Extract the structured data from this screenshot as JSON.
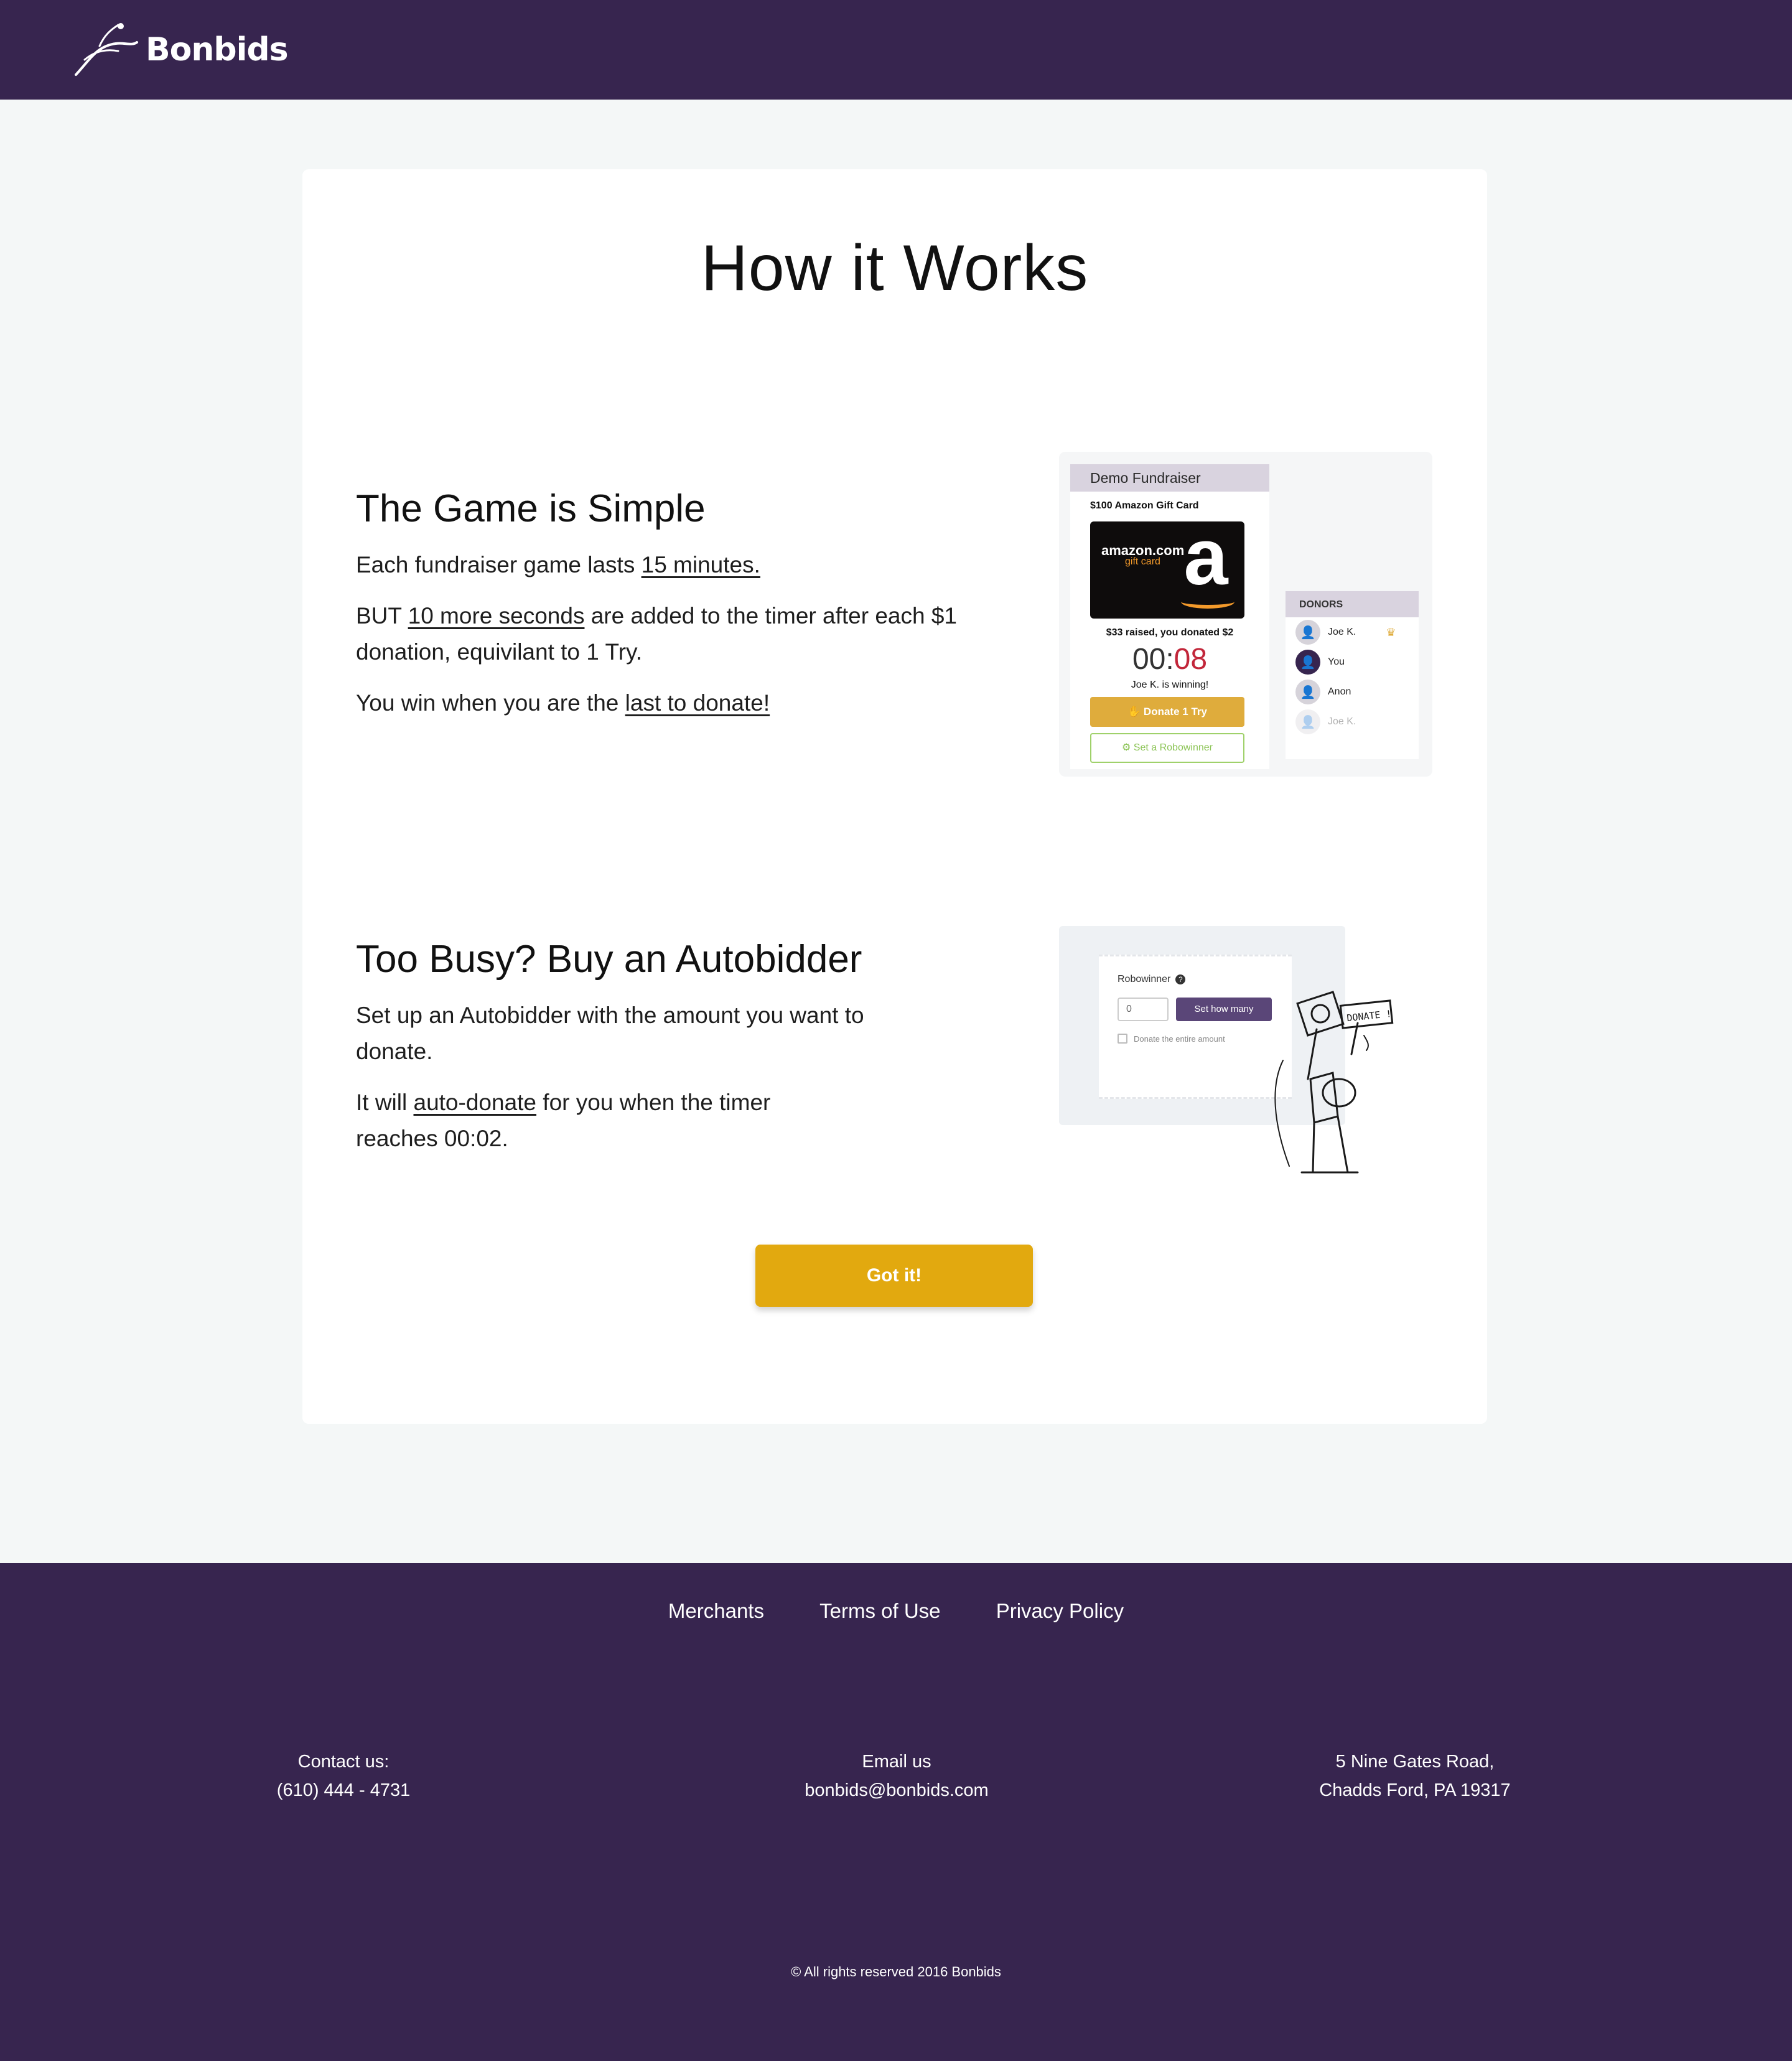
{
  "header": {
    "logo_text": "Bonbids"
  },
  "main": {
    "title": "How it Works",
    "section1": {
      "heading": "The Game is Simple",
      "p1_pre": "Each fundraiser game lasts ",
      "p1_link": "15 minutes. ",
      "p2_pre": "BUT ",
      "p2_link": "10 more seconds",
      "p2_post": " are added to the timer after each $1 donation, equivilant to 1 Try.",
      "p3_pre": "You win when you are the ",
      "p3_link": "last to donate!"
    },
    "section2": {
      "heading": "Too Busy? Buy an Autobidder",
      "p1": "Set up an Autobidder with the amount you want to donate.",
      "p2_pre": "It will ",
      "p2_link": "auto-donate",
      "p2_post": " for you when the timer reaches 00:02."
    },
    "got_it_label": "Got it!"
  },
  "demo": {
    "tab": "Demo Fundraiser",
    "gift_card_label": "$100 Amazon Gift Card",
    "amazon_text": "amazon.com",
    "amazon_sub": "gift card",
    "raised": "$33 raised, you donated $2",
    "timer_min": "00",
    "timer_sep": ":",
    "timer_sec": "08",
    "winning": "Joe K. is winning!",
    "donate_label": "Donate 1 Try",
    "robo_label": "Set a Robowinner",
    "donors_header": "DONORS",
    "donors": [
      "Joe K.",
      "You",
      "Anon",
      "Joe K."
    ]
  },
  "robowinner": {
    "label": "Robowinner",
    "input_value": "0",
    "set_label": "Set how many",
    "checkbox_label": "Donate the entire amount",
    "sign_text": "DONATE !"
  },
  "footer": {
    "links": [
      "Merchants",
      "Terms of Use",
      "Privacy Policy"
    ],
    "contact_title": "Contact us:",
    "contact_phone": "(610) 444 - 4731",
    "email_title": "Email us",
    "email": "bonbids@bonbids.com",
    "address_1": "5 Nine Gates Road,",
    "address_2": "Chadds Ford, PA 19317",
    "copyright": "© All rights reserved 2016 Bonbids"
  },
  "colors": {
    "brand": "#37254f",
    "accent": "#e2a90f",
    "timer_red": "#c2263a"
  }
}
